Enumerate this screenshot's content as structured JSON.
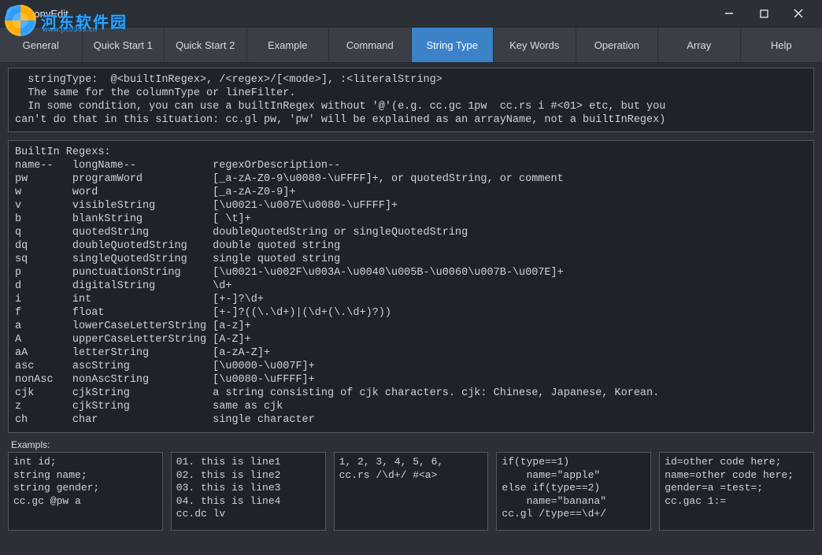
{
  "window": {
    "title": "ConyEdit"
  },
  "overlay": {
    "text_cn": "河东软件园",
    "sub": "www.pc0359.cn"
  },
  "tabs": [
    {
      "label": "General"
    },
    {
      "label": "Quick Start 1"
    },
    {
      "label": "Quick Start 2"
    },
    {
      "label": "Example"
    },
    {
      "label": "Command"
    },
    {
      "label": "String Type",
      "active": true
    },
    {
      "label": "Key Words"
    },
    {
      "label": "Operation"
    },
    {
      "label": "Array"
    },
    {
      "label": "Help"
    }
  ],
  "top_panel": "  stringType:  @<builtInRegex>, /<regex>/[<mode>], :<literalString>\n  The same for the columnType or lineFilter.\n  In some condition, you can use a builtInRegex without '@'(e.g. cc.gc 1pw  cc.rs i #<01> etc, but you\ncan't do that in this situation: cc.gl pw, 'pw' will be explained as an arrayName, not a builtInRegex)",
  "mid_panel": "BuiltIn Regexs:\nname--   longName--            regexOrDescription--\npw       programWord           [_a-zA-Z0-9\\u0080-\\uFFFF]+, or quotedString, or comment\nw        word                  [_a-zA-Z0-9]+\nv        visibleString         [\\u0021-\\u007E\\u0080-\\uFFFF]+\nb        blankString           [ \\t]+\nq        quotedString          doubleQuotedString or singleQuotedString\ndq       doubleQuotedString    double quoted string\nsq       singleQuotedString    single quoted string\np        punctuationString     [\\u0021-\\u002F\\u003A-\\u0040\\u005B-\\u0060\\u007B-\\u007E]+\nd        digitalString         \\d+\ni        int                   [+-]?\\d+\nf        float                 [+-]?((\\.\\d+)|(\\d+(\\.\\d+)?))\na        lowerCaseLetterString [a-z]+\nA        upperCaseLetterString [A-Z]+\naA       letterString          [a-zA-Z]+\nasc      ascString             [\\u0000-\\u007F]+\nnonAsc   nonAscString          [\\u0080-\\uFFFF]+\ncjk      cjkString             a string consisting of cjk characters. cjk: Chinese, Japanese, Korean.\nz        cjkString             same as cjk\nch       char                  single character",
  "examples_label": "Exampls:",
  "examples": [
    "int id;\nstring name;\nstring gender;\ncc.gc @pw a",
    "01. this is line1\n02. this is line2\n03. this is line3\n04. this is line4\ncc.dc lv",
    "1, 2, 3, 4, 5, 6,\ncc.rs /\\d+/ #<a>",
    "if(type==1)\n    name=\"apple\"\nelse if(type==2)\n    name=\"banana\"\ncc.gl /type==\\d+/",
    "id=other code here;\nname=other code here;\ngender=a =test=;\ncc.gac 1:="
  ]
}
